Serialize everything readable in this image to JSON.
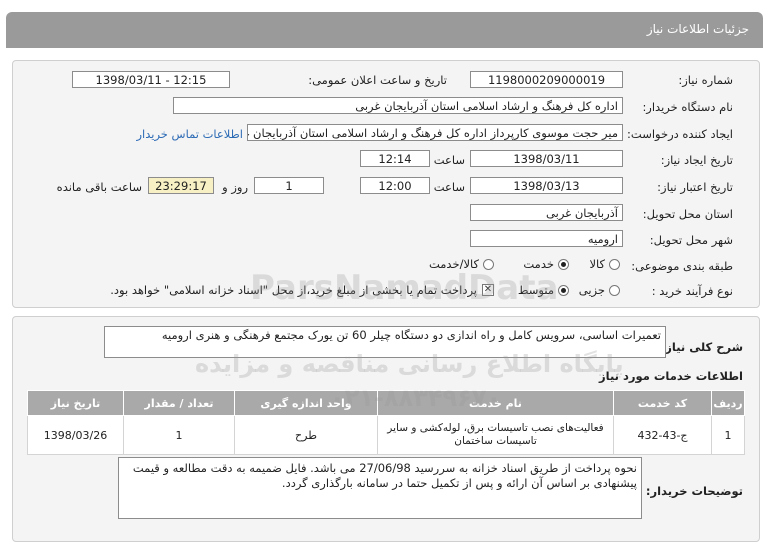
{
  "header": {
    "title": "جزئیات اطلاعات نیاز"
  },
  "fields": {
    "need_number_label": "شماره نیاز:",
    "need_number": "1198000209000019",
    "announce_label": "تاریخ و ساعت اعلان عمومی:",
    "announce_value": "1398/03/11 - 12:15",
    "buyer_label": "نام دستگاه خریدار:",
    "buyer_value": "اداره کل فرهنگ و ارشاد اسلامی استان آذربایجان غربی",
    "requester_label": "ایجاد کننده درخواست:",
    "requester_value": "میر حجت موسوی کارپرداز اداره کل فرهنگ و ارشاد اسلامی استان آذربایجان غر",
    "contact_link": "اطلاعات تماس خریدار",
    "create_date_label": "تاریخ ایجاد نیاز:",
    "create_date": "1398/03/11",
    "time_label": "ساعت",
    "create_time": "12:14",
    "validity_label": "تاریخ اعتبار نیاز:",
    "validity_date": "1398/03/13",
    "validity_time": "12:00",
    "days_value": "1",
    "day_and_label": "روز و",
    "remaining_time": "23:29:17",
    "remaining_label": "ساعت باقی مانده",
    "province_label": "استان محل تحویل:",
    "province_value": "آذربایجان غربی",
    "city_label": "شهر محل تحویل:",
    "city_value": "ارومیه",
    "category_label": "طبقه بندی موضوعی:",
    "category_options": [
      "کالا",
      "خدمت",
      "کالا/خدمت"
    ],
    "process_label": "نوع فرآیند خرید :",
    "process_options": [
      "جزیی",
      "متوسط"
    ],
    "payment_note": "پرداخت تمام یا بخشی از مبلغ خرید،از محل \"اسناد خزانه اسلامی\" خواهد بود."
  },
  "summary": {
    "label": "شرح کلی نیاز:",
    "value": "تعمیرات اساسی، سرویس کامل و راه اندازی دو دستگاه چیلر 60 تن یورک مجتمع فرهنگی و هنری ارومیه"
  },
  "services": {
    "title": "اطلاعات خدمات مورد نیاز",
    "columns": [
      "ردیف",
      "کد خدمت",
      "نام خدمت",
      "واحد اندازه گیری",
      "تعداد / مقدار",
      "تاریخ نیاز"
    ],
    "rows": [
      [
        "1",
        "ج-43-432",
        "فعالیت‌های نصب تاسیسات برق، لوله‌کشی و سایر تاسیسات ساختمان",
        "طرح",
        "1",
        "1398/03/26"
      ]
    ]
  },
  "buyer_notes": {
    "label": "توضیحات خریدار:",
    "value": "نحوه پرداخت از طریق اسناد خزانه به سررسید 27/06/98 می باشد. فایل ضمیمه به دقت مطالعه و قیمت پیشنهادی بر اساس آن ارائه و پس از تکمیل حتما در سامانه بارگذاری گردد."
  },
  "watermark": {
    "brand": "ParsNamadData",
    "text": "پایگاه اطلاع رسانی مناقصه و مزایده",
    "phone": "۰۲۱-۸۸۳۴۹۶۷۰"
  }
}
